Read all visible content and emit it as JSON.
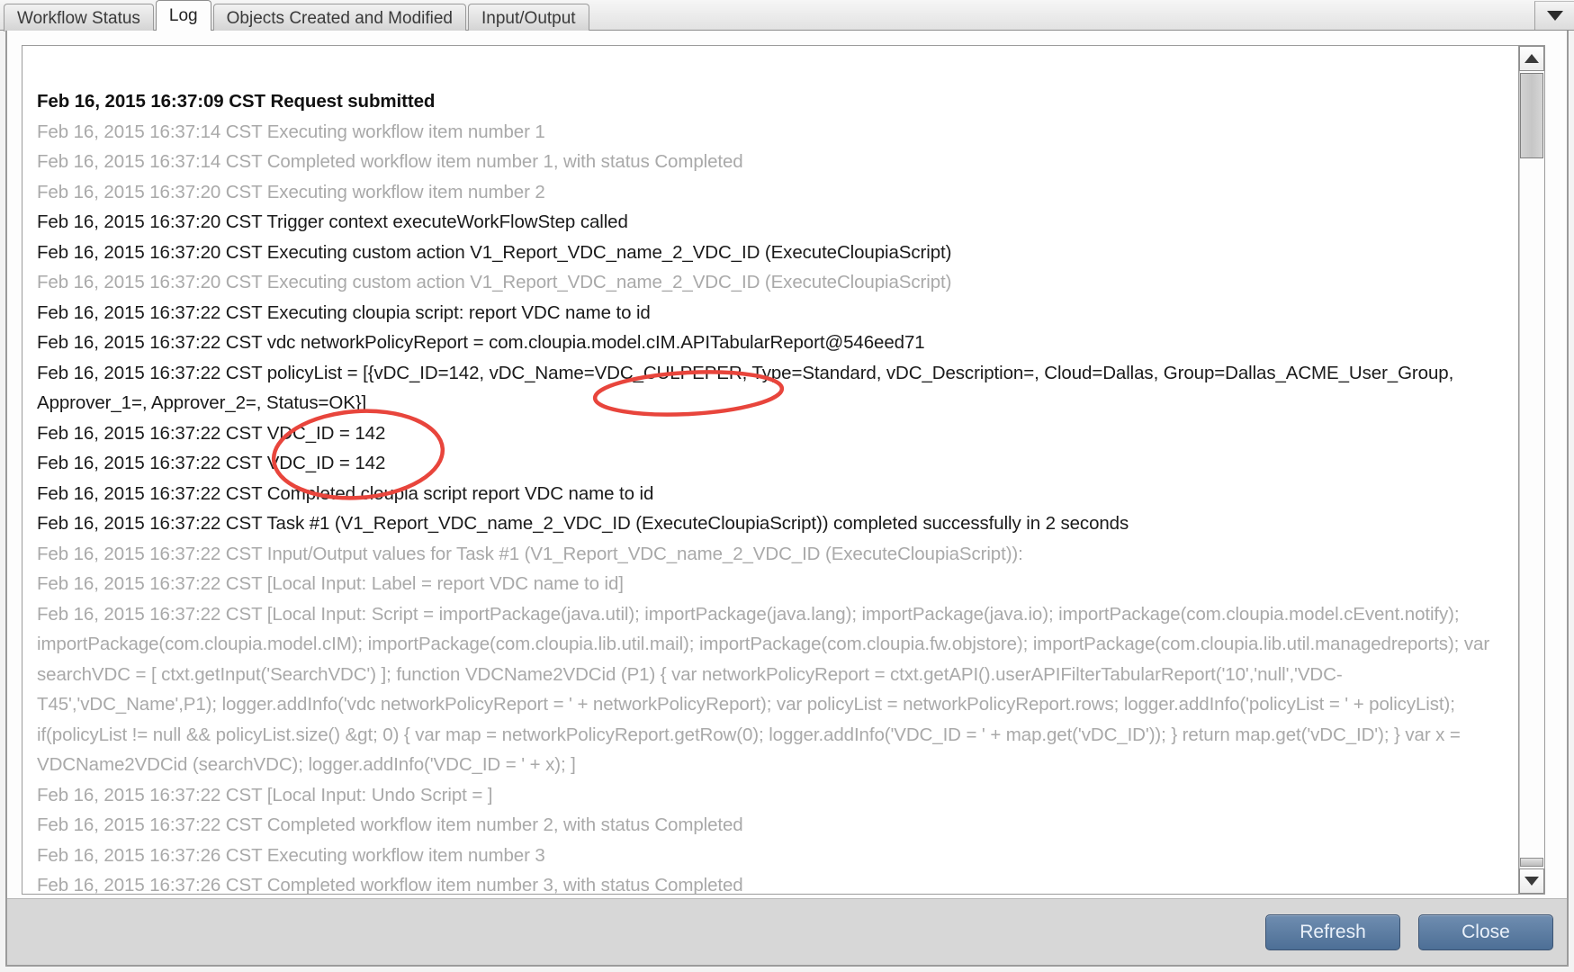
{
  "window": {
    "overflow_icon": "chevron-down-icon"
  },
  "tabs": [
    {
      "id": "workflow-status",
      "label": "Workflow Status",
      "active": false
    },
    {
      "id": "log",
      "label": "Log",
      "active": true
    },
    {
      "id": "objects-created-modified",
      "label": "Objects Created and Modified",
      "active": false
    },
    {
      "id": "input-output",
      "label": "Input/Output",
      "active": false
    }
  ],
  "log": {
    "lines": [
      {
        "text": "Feb 16, 2015 16:37:09 CST Request submitted",
        "style": "hl"
      },
      {
        "text": "Feb 16, 2015 16:37:14 CST Executing workflow item number 1",
        "style": "dim"
      },
      {
        "text": "Feb 16, 2015 16:37:14 CST Completed workflow item number 1, with status Completed",
        "style": "dim"
      },
      {
        "text": "Feb 16, 2015 16:37:20 CST Executing workflow item number 2",
        "style": "dim"
      },
      {
        "text": "Feb 16, 2015 16:37:20 CST Trigger context executeWorkFlowStep called",
        "style": "blk"
      },
      {
        "text": "Feb 16, 2015 16:37:20 CST Executing custom action V1_Report_VDC_name_2_VDC_ID (ExecuteCloupiaScript)",
        "style": "blk"
      },
      {
        "text": "Feb 16, 2015 16:37:20 CST Executing custom action V1_Report_VDC_name_2_VDC_ID (ExecuteCloupiaScript)",
        "style": "dim"
      },
      {
        "text": "Feb 16, 2015 16:37:22 CST Executing cloupia script: report VDC name to id",
        "style": "blk"
      },
      {
        "text": "Feb 16, 2015 16:37:22 CST vdc networkPolicyReport = com.cloupia.model.cIM.APITabularReport@546eed71",
        "style": "blk"
      },
      {
        "text": "Feb 16, 2015 16:37:22 CST policyList = [{vDC_ID=142, vDC_Name=VDC_CULPEPER, Type=Standard, vDC_Description=, Cloud=Dallas, Group=Dallas_ACME_User_Group, Approver_1=, Approver_2=, Status=OK}]",
        "style": "blk"
      },
      {
        "text": "Feb 16, 2015 16:37:22 CST VDC_ID = 142",
        "style": "blk"
      },
      {
        "text": "Feb 16, 2015 16:37:22 CST VDC_ID = 142",
        "style": "blk"
      },
      {
        "text": "Feb 16, 2015 16:37:22 CST Completed cloupia script report VDC name to id",
        "style": "blk"
      },
      {
        "text": "Feb 16, 2015 16:37:22 CST Task #1 (V1_Report_VDC_name_2_VDC_ID (ExecuteCloupiaScript)) completed successfully in 2 seconds",
        "style": "blk"
      },
      {
        "text": "Feb 16, 2015 16:37:22 CST Input/Output values for Task #1 (V1_Report_VDC_name_2_VDC_ID (ExecuteCloupiaScript)):",
        "style": "dim"
      },
      {
        "text": "Feb 16, 2015 16:37:22 CST [Local Input: Label = report VDC name to id]",
        "style": "dim"
      },
      {
        "text": "Feb 16, 2015 16:37:22 CST [Local Input: Script = importPackage(java.util); importPackage(java.lang); importPackage(java.io); importPackage(com.cloupia.model.cEvent.notify); importPackage(com.cloupia.model.cIM); importPackage(com.cloupia.lib.util.mail); importPackage(com.cloupia.fw.objstore); importPackage(com.cloupia.lib.util.managedreports); var searchVDC = [ ctxt.getInput('SearchVDC') ]; function VDCName2VDCid (P1) { var networkPolicyReport = ctxt.getAPI().userAPIFilterTabularReport('10','null','VDC-T45','vDC_Name',P1); logger.addInfo('vdc networkPolicyReport = ' + networkPolicyReport); var policyList = networkPolicyReport.rows; logger.addInfo('policyList = ' + policyList); if(policyList != null && policyList.size() &gt; 0) { var map = networkPolicyReport.getRow(0); logger.addInfo('VDC_ID = ' + map.get('vDC_ID')); } return map.get('vDC_ID'); } var x = VDCName2VDCid (searchVDC); logger.addInfo('VDC_ID = ' + x); ]",
        "style": "dim"
      },
      {
        "text": "Feb 16, 2015 16:37:22 CST [Local Input: Undo Script = ]",
        "style": "dim"
      },
      {
        "text": "Feb 16, 2015 16:37:22 CST Completed workflow item number 2, with status Completed",
        "style": "dim"
      },
      {
        "text": "Feb 16, 2015 16:37:26 CST Executing workflow item number 3",
        "style": "dim"
      },
      {
        "text": "Feb 16, 2015 16:37:26 CST Completed workflow item number 3, with status Completed",
        "style": "dim"
      }
    ]
  },
  "annotations": {
    "color": "#e8453c",
    "ellipses": [
      {
        "name": "vdc-name-highlight",
        "label": "VDC_CULPEPER"
      },
      {
        "name": "vdc-id-highlight",
        "label": "VDC_ID = 142"
      }
    ]
  },
  "scrollbar": {
    "up_icon": "triangle-up-icon",
    "down_icon": "triangle-down-icon"
  },
  "footer": {
    "refresh_label": "Refresh",
    "close_label": "Close"
  }
}
